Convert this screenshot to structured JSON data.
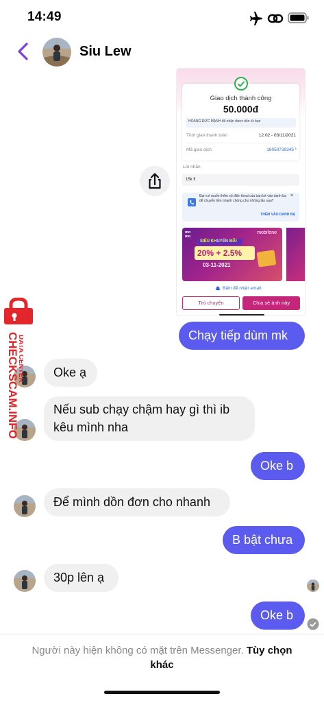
{
  "status_bar": {
    "time": "14:49",
    "icons": [
      "airplane-icon",
      "link-icon",
      "battery-icon"
    ]
  },
  "header": {
    "contact_name": "Siu Lew",
    "back_icon": "chevron-left-icon"
  },
  "shared_image": {
    "title": "Giao dịch thành công",
    "amount": "50.000đ",
    "receiver_note": "HOÀNG ĐỨC MẠNH đã nhận được tiền từ bạn",
    "time_label": "Thời gian thanh toán",
    "time_value": "12:02 - 03/11/2021",
    "code_label": "Mã giao dịch",
    "code_value": "18050739345",
    "message_label": "Lời nhắn",
    "message_value": "15k fl",
    "contact_prompt": "Bạn có muốn thêm số điện thoại của bạn bè vào danh bạ để chuyển tiền nhanh chóng cho những lần sau?",
    "contact_action": "THÊM VÀO DANH BẠ",
    "promo_brand": "mobifone",
    "promo_title": "SIÊU KHUYẾN MÃI",
    "promo_percent": "20% + 2.5%",
    "promo_date": "03-11-2021",
    "email_note": "Bấm để nhận email",
    "btn_chat": "Trò chuyện",
    "btn_share": "Chia sẻ ảnh này"
  },
  "messages": [
    {
      "side": "out",
      "text": "Chạy tiếp dùm mk"
    },
    {
      "side": "in",
      "text": "Oke ạ"
    },
    {
      "side": "in",
      "line1": "Nếu sub chạy chậm hay gì thì ib",
      "line2": "kêu mình nha"
    },
    {
      "side": "out",
      "text": "Oke b"
    },
    {
      "side": "in",
      "text": "Để mình dồn đơn cho nhanh"
    },
    {
      "side": "out",
      "text": "B bật chưa"
    },
    {
      "side": "in",
      "text": "30p lên ạ"
    },
    {
      "side": "out",
      "text": "Oke b"
    }
  ],
  "watermark": {
    "line1": "CHECKSCAM.INFO",
    "line2": "DATA CENTER"
  },
  "footer": {
    "notice": "Người này hiện không có mặt trên Messenger.",
    "action": "Tùy chọn khác"
  },
  "colors": {
    "outgoing_bubble": "#5b5bf0",
    "incoming_bubble": "#f0f0f0",
    "accent": "#7b3fe4",
    "watermark": "#e3262b"
  }
}
